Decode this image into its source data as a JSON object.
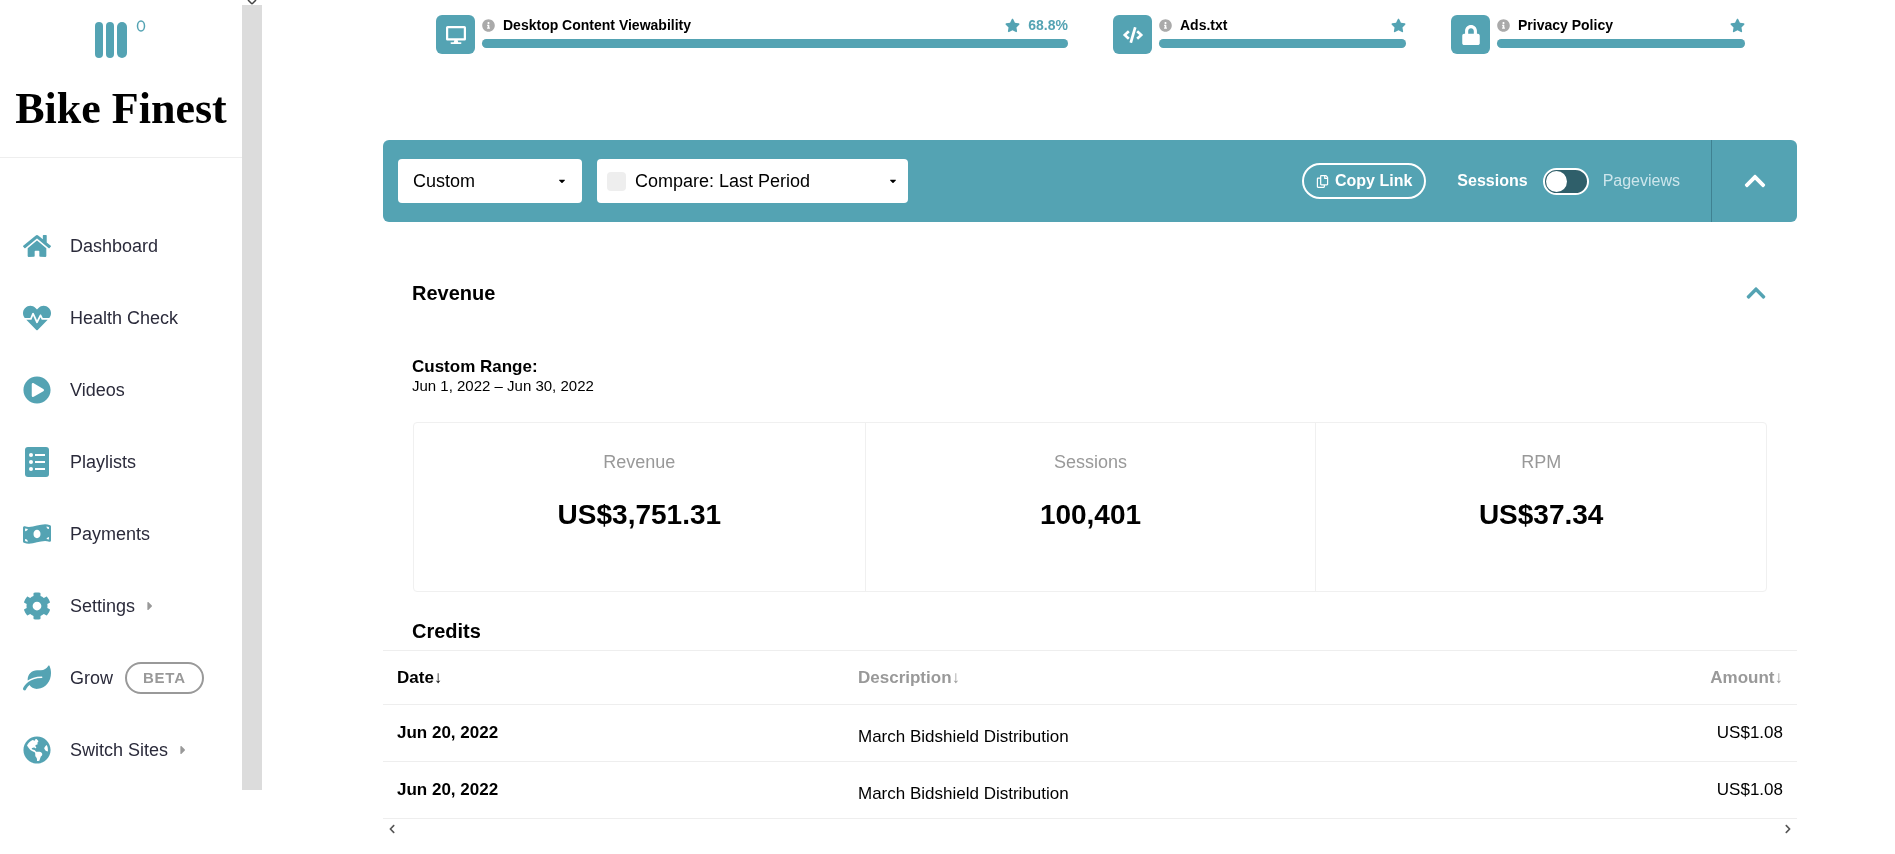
{
  "sidebar": {
    "brand": "Bike Finest",
    "items": [
      {
        "label": "Dashboard",
        "has_submenu": false
      },
      {
        "label": "Health Check",
        "has_submenu": false
      },
      {
        "label": "Videos",
        "has_submenu": false
      },
      {
        "label": "Playlists",
        "has_submenu": false
      },
      {
        "label": "Payments",
        "has_submenu": false
      },
      {
        "label": "Settings",
        "has_submenu": true
      },
      {
        "label": "Grow",
        "has_submenu": false,
        "badge": "BETA"
      },
      {
        "label": "Switch Sites",
        "has_submenu": true
      }
    ]
  },
  "health_metrics": [
    {
      "title": "Desktop Content Viewability",
      "value": "68.8%",
      "level": 1
    },
    {
      "title": "Ads.txt",
      "level": 1
    },
    {
      "title": "Privacy Policy",
      "level": 1
    }
  ],
  "toolbar": {
    "range_select": "Custom",
    "compare_select": "Compare: Last Period",
    "compare_checked": false,
    "copy_link": "Copy Link",
    "toggle": {
      "left_label": "Sessions",
      "right_label": "Pageviews",
      "on": false
    }
  },
  "revenue": {
    "title": "Revenue",
    "expanded": true,
    "range_label": "Custom Range:",
    "range": "Jun 1, 2022 – Jun 30, 2022",
    "stats": [
      {
        "label": "Revenue",
        "value": "US$3,751.31"
      },
      {
        "label": "Sessions",
        "value": "100,401"
      },
      {
        "label": "RPM",
        "value": "US$37.34"
      }
    ]
  },
  "credits": {
    "title": "Credits",
    "columns": [
      {
        "label": "Date",
        "sort": "↓",
        "selected": true
      },
      {
        "label": "Description",
        "sort": "↓",
        "selected": false
      },
      {
        "label": "Amount",
        "sort": "↓",
        "selected": false
      }
    ],
    "rows": [
      [
        "Jun 20, 2022",
        "March Bidshield Distribution",
        "US$1.08"
      ],
      [
        "Jun 20, 2022",
        "March Bidshield Distribution",
        "US$1.08"
      ]
    ]
  }
}
